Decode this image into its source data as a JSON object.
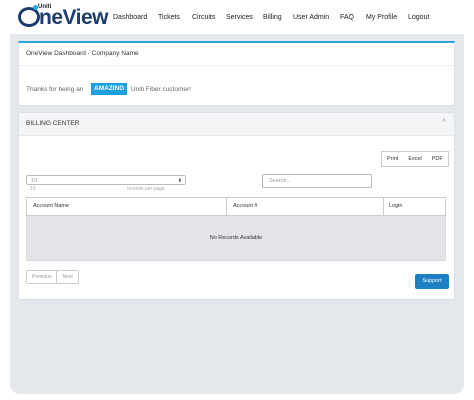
{
  "logo": {
    "brand_small": "Uniti",
    "wordmark": "neView",
    "trademark": "™"
  },
  "nav": {
    "items": [
      {
        "label": "Dashboard"
      },
      {
        "label": "Tickets"
      },
      {
        "label": "Circuits"
      },
      {
        "label": "Services"
      },
      {
        "label": "Billing"
      },
      {
        "label": "User Admin"
      },
      {
        "label": "FAQ"
      },
      {
        "label": "My Profile"
      },
      {
        "label": "Logout"
      }
    ]
  },
  "dashboard": {
    "title": "OneView Dashboard - Company Name",
    "thanks_prefix": "Thanks for being an",
    "badge": "AMAZING",
    "thanks_suffix": "Uniti Fiber customer!"
  },
  "billing": {
    "title": "BILLING CENTER",
    "collapse_icon": "chevron-up",
    "buttons": [
      "Print",
      "Excel",
      "PDF"
    ],
    "page_length": {
      "value": "10",
      "sub_value": "10",
      "label": "records per page"
    },
    "search": {
      "placeholder": "Search..."
    },
    "columns": [
      "Account Name",
      "Account #",
      "Login"
    ],
    "empty_message": "No Records Available",
    "pager": {
      "previous": "Previous",
      "next": "Next"
    },
    "support_button": "Support"
  },
  "colors": {
    "accent": "#1da0de",
    "brand_navy": "#1d3c6e",
    "support_button": "#1b81c4",
    "background": "#e4e7ec"
  }
}
